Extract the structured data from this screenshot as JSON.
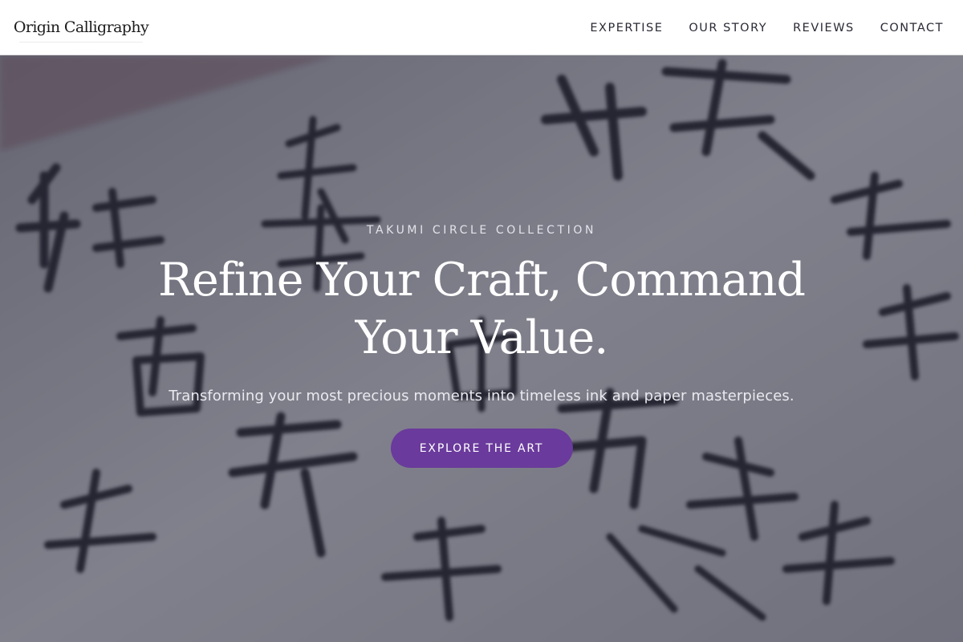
{
  "header": {
    "logo_text": "Origin Calligraphy",
    "nav": [
      {
        "label": "EXPERTISE"
      },
      {
        "label": "OUR STORY"
      },
      {
        "label": "REVIEWS"
      },
      {
        "label": "CONTACT"
      }
    ]
  },
  "hero": {
    "eyebrow": "TAKUMI CIRCLE COLLECTION",
    "headline_line1": "Refine Your Craft, Command",
    "headline_line2": "Your Value.",
    "subtitle": "Transforming your most precious moments into timeless ink and paper masterpieces.",
    "cta_label": "EXPLORE THE ART",
    "background_image": "calligraphy-brush-strokes-on-paper"
  },
  "colors": {
    "accent": "#6a3a9c",
    "header_bg": "#ffffff",
    "nav_text": "#2a2a35",
    "hero_overlay": "#343446"
  }
}
